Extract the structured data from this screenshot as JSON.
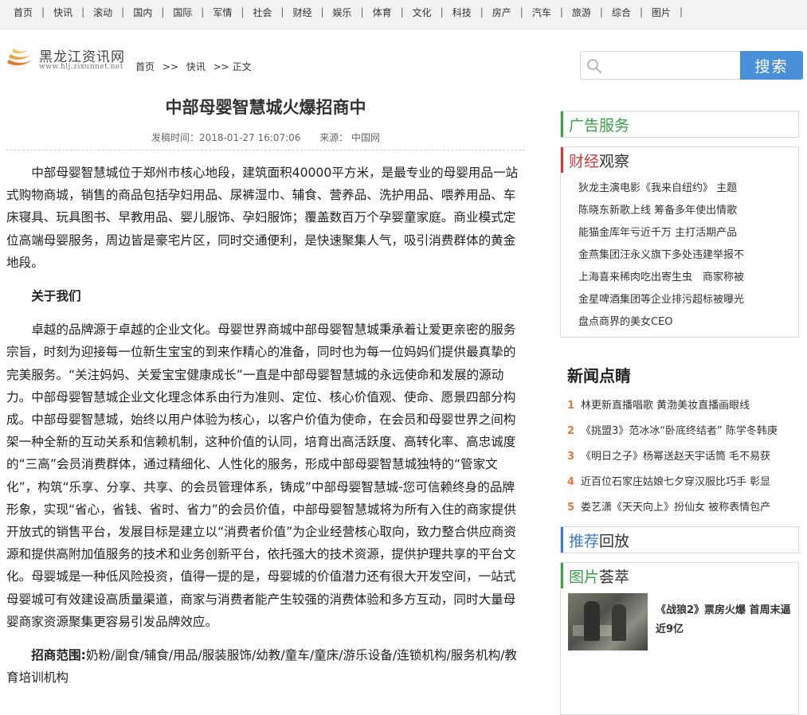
{
  "nav": {
    "items": [
      "首页",
      "快讯",
      "滚动",
      "国内",
      "国际",
      "军情",
      "社会",
      "财经",
      "娱乐",
      "体育",
      "文化",
      "科技",
      "房产",
      "汽车",
      "旅游",
      "综合",
      "图片"
    ],
    "separator": "|"
  },
  "logo": {
    "name": "黑龙江资讯网",
    "url": "www.hlj.zixunnet.net"
  },
  "breadcrumb": {
    "home": "首页",
    "sep1": ">>",
    "section": "快讯",
    "sep2": ">>",
    "current": "正文"
  },
  "search": {
    "placeholder": "",
    "button_label": "搜索"
  },
  "article": {
    "title": "中部母婴智慧城火爆招商中",
    "publish_time": "发稿时间：2018-01-27 16:07:06",
    "source": "来源： 中国网",
    "para1": "中部母婴智慧城位于郑州市核心地段，建筑面积40000平方米，是最专业的母婴用品一站式购物商城，销售的商品包括孕妇用品、尿裤湿巾、辅食、营养品、洗护用品、喂养用品、车床寝具、玩具图书、早教用品、婴儿服饰、孕妇服饰；覆盖数百万个孕婴童家庭。商业模式定位高端母婴服务，周边皆是豪宅片区，同时交通便利，是快速聚集人气，吸引消费群体的黄金地段。",
    "about_heading": "关于我们",
    "para2": "卓越的品牌源于卓越的企业文化。母婴世界商城中部母婴智慧城秉承着让爱更亲密的服务宗旨，时刻为迎接每一位新生宝宝的到来作精心的准备，同时也为每一位妈妈们提供最真挚的完美服务。“关注妈妈、关爱宝宝健康成长”一直是中部母婴智慧城的永远使命和发展的源动力。中部母婴智慧城企业文化理念体系由行为准则、定位、核心价值观、使命、愿景四部分构成。中部母婴智慧城，始终以用户体验为核心，以客户价值为使命，在会员和母婴世界之间构架一种全新的互动关系和信赖机制，这种价值的认同，培育出高活跃度、高转化率、高忠诚度的“三高”会员消费群体，通过精细化、人性化的服务，形成中部母婴智慧城独特的“管家文化”，构筑“乐享、分享、共享、的会员管理体系，铸成”中部母婴智慧城-您可信赖终身的品牌形象，实现“省心，省钱、省时、省力”的会员价值，中部母婴智慧城将为所有入住的商家提供开放式的销售平台，发展目标是建立以“消费者价值”为企业经营核心取向，致力整合供应商资源和提供高附加值服务的技术和业务创新平台，依托强大的技术资源，提供护理共享的平台文化。母婴城是一种低风险投资，值得一提的是，母婴城的价值潜力还有很大开发空间，一站式母婴城可有效建设高质量渠道，商家与消费者能产生较强的消费体验和多方互动，同时大量母婴商家资源聚集更容易引发品牌效应。",
    "scope_label": "招商范围:",
    "scope_text": "奶粉/副食/辅食/用品/服装服饰/幼教/童车/童床/游乐设备/连锁机构/服务机构/教育培训机构"
  },
  "sidebar": {
    "ad": {
      "title": "广告服务"
    },
    "finance": {
      "title_part1": "财经",
      "title_part2": "观察",
      "items": [
        "狄龙主演电影《我来自纽约》 主题",
        "陈晓东新歌上线 筹备多年使出情歌",
        "能猫金库年亏近千万 主打活期产品",
        "金燕集团汪永义旗下多处违建举报不",
        "上海喜来稀肉吃出寄生虫　商家称被",
        "金星啤酒集团等企业排污超标被曝光",
        "盘点商界的美女CEO"
      ]
    },
    "hot": {
      "title": "新闻点睛",
      "items": [
        {
          "num": "1",
          "text": "林更新直播唱歌 黄渤美妆直播画眼线"
        },
        {
          "num": "2",
          "text": "《挑盟3》范冰冰“卧底终结者” 陈学冬韩庚"
        },
        {
          "num": "3",
          "text": "《明日之子》杨幂送赵天宇话筒 毛不易获"
        },
        {
          "num": "4",
          "text": "近百位石家庄姑娘七夕穿汉服比巧手 彰显"
        },
        {
          "num": "5",
          "text": "娄艺潇《天天向上》扮仙女 被称表情包产"
        }
      ]
    },
    "recommend": {
      "title_part1": "推荐",
      "title_part2": "回放"
    },
    "pictures": {
      "title_part1": "图片",
      "title_part2": "荟萃",
      "caption": "《战狼2》票房火爆 首周末逼近9亿"
    }
  },
  "colors": {
    "accent_green": "#3aa04a",
    "accent_red": "#d03c3c",
    "accent_blue": "#3d7bc8",
    "search_button": "#4a90d9",
    "hot_number": "#e4783c"
  }
}
